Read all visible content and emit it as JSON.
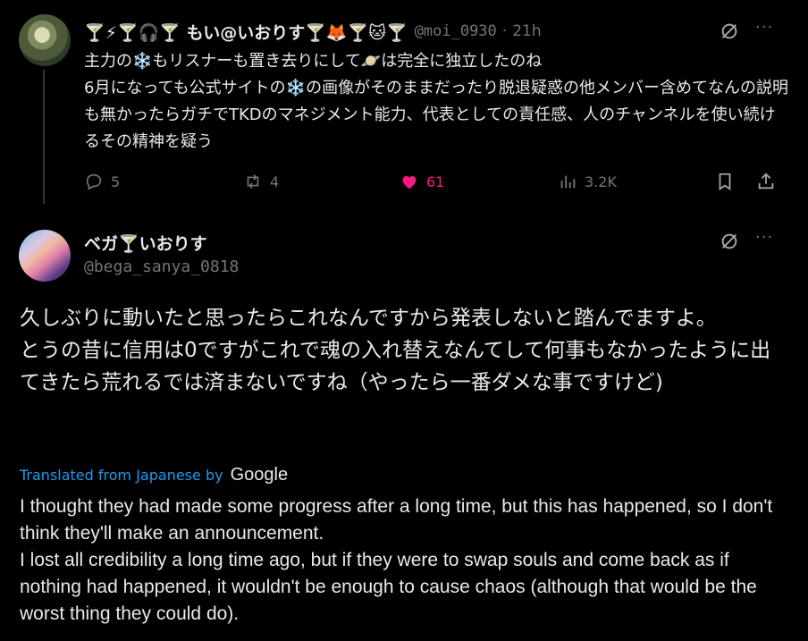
{
  "tweet1": {
    "display_name": "🍸⚡🍸🎧🍸 もい@いおりす🍸🦊🍸🐱🍸",
    "handle": "@moi_0930",
    "separator": "·",
    "time": "21h",
    "body": "主力の❄️もリスナーも置き去りにして🪐は完全に独立したのね\n6月になっても公式サイトの❄️の画像がそのままだったり脱退疑惑の他メンバー含めてなんの説明も無かったらガチでTKDのマネジメント能力、代表としての責任感、人のチャンネルを使い続けるその精神を疑う",
    "actions": {
      "replies": "5",
      "reposts": "4",
      "likes": "61",
      "views": "3.2K"
    }
  },
  "tweet2": {
    "display_name": "ベガ🍸いおりす",
    "handle": "@bega_sanya_0818",
    "body": "久しぶりに動いたと思ったらこれなんですから発表しないと踏んでますよ。\nとうの昔に信用は0ですがこれで魂の入れ替えなんてして何事もなかったように出てきたら荒れるでは済まないですね（やったら一番ダメな事ですけど)",
    "translated_label": "Translated from Japanese by",
    "translator": "Google",
    "translation": "I thought they had made some progress after a long time, but this has happened, so I don't think they'll make an announcement.\nI lost all credibility a long time ago, but if they were to swap souls and come back as if nothing had happened, it wouldn't be enough to cause chaos (although that would be the worst thing they could do)."
  },
  "more_label": "···",
  "colors": {
    "background": "#000000",
    "text": "#e7e9ea",
    "muted": "#71767b",
    "link": "#1d9bf0",
    "like": "#f91880"
  }
}
